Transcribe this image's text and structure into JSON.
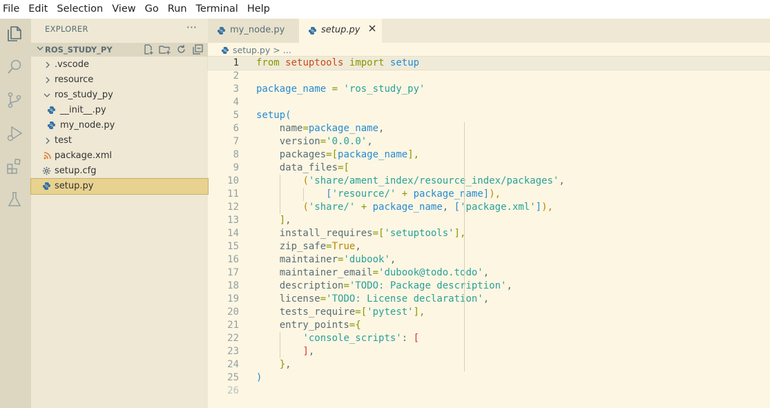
{
  "menu": [
    "File",
    "Edit",
    "Selection",
    "View",
    "Go",
    "Run",
    "Terminal",
    "Help"
  ],
  "activity_icons": [
    "explorer-icon",
    "search-icon",
    "source-control-icon",
    "run-debug-icon",
    "extensions-icon",
    "testing-icon"
  ],
  "sidebar": {
    "header": "EXPLORER",
    "more": "···",
    "section_title": "ROS_STUDY_PY",
    "tree": [
      {
        "label": ".vscode",
        "type": "folder",
        "expanded": false,
        "depth": 0
      },
      {
        "label": "resource",
        "type": "folder",
        "expanded": false,
        "depth": 0
      },
      {
        "label": "ros_study_py",
        "type": "folder",
        "expanded": true,
        "depth": 0
      },
      {
        "label": "__init__.py",
        "type": "python",
        "depth": 1
      },
      {
        "label": "my_node.py",
        "type": "python",
        "depth": 1
      },
      {
        "label": "test",
        "type": "folder",
        "expanded": false,
        "depth": 0
      },
      {
        "label": "package.xml",
        "type": "xml",
        "depth": 0
      },
      {
        "label": "setup.cfg",
        "type": "config",
        "depth": 0
      },
      {
        "label": "setup.py",
        "type": "python",
        "depth": 0,
        "selected": true
      }
    ]
  },
  "tabs": [
    {
      "label": "my_node.py",
      "active": false
    },
    {
      "label": "setup.py",
      "active": true
    }
  ],
  "breadcrumb": {
    "file": "setup.py",
    "sep": ">",
    "rest": "..."
  },
  "code_lines": [
    "1",
    "2",
    "3",
    "4",
    "5",
    "6",
    "7",
    "8",
    "9",
    "10",
    "11",
    "12",
    "13",
    "14",
    "15",
    "16",
    "17",
    "18",
    "19",
    "20",
    "21",
    "22",
    "23",
    "24",
    "25",
    "26"
  ],
  "code": {
    "l1": [
      "from",
      "setuptools",
      "import",
      "setup"
    ],
    "l3": [
      "package_name",
      "=",
      "'ros_study_py'"
    ],
    "l5": [
      "setup",
      "("
    ],
    "l6": [
      "name",
      "=",
      "package_name",
      ","
    ],
    "l7": [
      "version",
      "=",
      "'0.0.0'",
      ","
    ],
    "l8": [
      "packages",
      "=",
      "[",
      "package_name",
      "],"
    ],
    "l9": [
      "data_files",
      "=",
      "["
    ],
    "l10": [
      "(",
      "'share/ament_index/resource_index/packages'",
      ","
    ],
    "l11": [
      "[",
      "'resource/'",
      "+",
      "package_name",
      "]",
      "),"
    ],
    "l12": [
      "(",
      "'share/'",
      "+",
      "package_name",
      ",",
      "[",
      "'package.xml'",
      "]",
      "),"
    ],
    "l13": [
      "]",
      ","
    ],
    "l14": [
      "install_requires",
      "=",
      "[",
      "'setuptools'",
      "],"
    ],
    "l15": [
      "zip_safe",
      "=",
      "True",
      ","
    ],
    "l16": [
      "maintainer",
      "=",
      "'dubook'",
      ","
    ],
    "l17": [
      "maintainer_email",
      "=",
      "'dubook@todo.todo'",
      ","
    ],
    "l18": [
      "description",
      "=",
      "'TODO: Package description'",
      ","
    ],
    "l19": [
      "license",
      "=",
      "'TODO: License declaration'",
      ","
    ],
    "l20": [
      "tests_require",
      "=",
      "[",
      "'pytest'",
      "],"
    ],
    "l21": [
      "entry_points",
      "=",
      "{"
    ],
    "l22": [
      "'console_scripts'",
      ":",
      "["
    ],
    "l23": [
      "]",
      ","
    ],
    "l24": [
      "}",
      ","
    ],
    "l25": [
      ")"
    ]
  },
  "colors": {
    "editor_bg": "#fdf6e3",
    "sidebar_bg": "#eee8d5",
    "activity_bg": "#ddd6c1",
    "selection": "#e8d28f",
    "keyword": "#859900",
    "function": "#268bd2",
    "string": "#2aa198"
  }
}
